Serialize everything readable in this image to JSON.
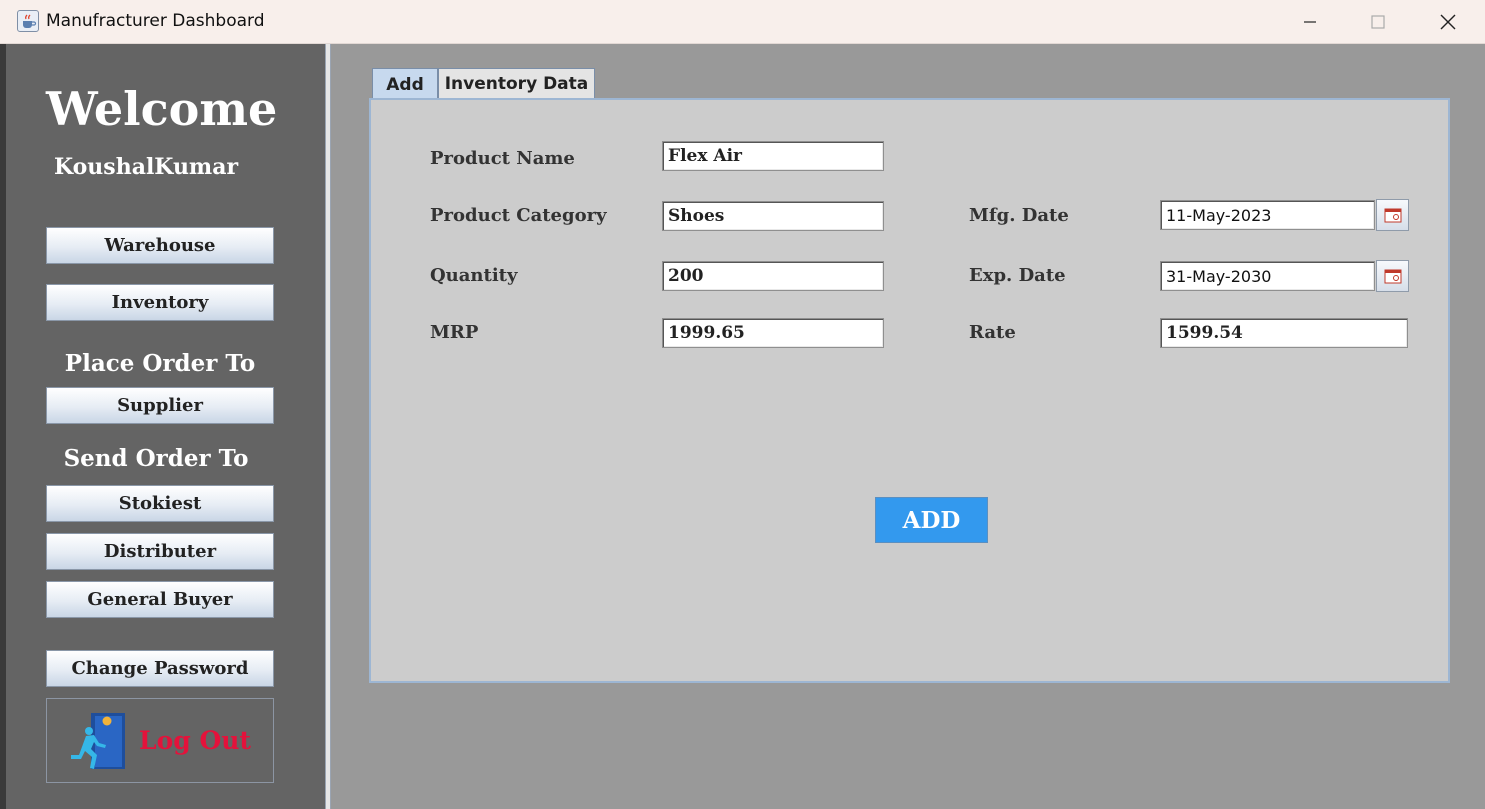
{
  "window": {
    "title": "Manufracturer Dashboard",
    "icon": "java-cup-icon"
  },
  "sidebar": {
    "welcome": "Welcome",
    "username": "KoushalKumar",
    "place_order_label": "Place Order To",
    "send_order_label": "Send Order To",
    "buttons": {
      "warehouse": "Warehouse",
      "inventory": "Inventory",
      "supplier": "Supplier",
      "stokiest": "Stokiest",
      "distributer": "Distributer",
      "general_buyer": "General Buyer",
      "change_password": "Change Password",
      "logout": "Log Out"
    }
  },
  "tabs": {
    "add": "Add",
    "inventory_data": "Inventory Data"
  },
  "form": {
    "product_name": {
      "label": "Product Name",
      "value": "Flex Air"
    },
    "product_category": {
      "label": "Product Category",
      "value": "Shoes"
    },
    "quantity": {
      "label": "Quantity",
      "value": "200"
    },
    "mrp": {
      "label": "MRP",
      "value": "1999.65"
    },
    "mfg_date": {
      "label": "Mfg. Date",
      "value": "11-May-2023"
    },
    "exp_date": {
      "label": "Exp. Date",
      "value": "31-May-2030"
    },
    "rate": {
      "label": "Rate",
      "value": "1599.54"
    },
    "submit_label": "ADD"
  },
  "colors": {
    "sidebar_bg": "#646464",
    "content_bg": "#999999",
    "panel_bg": "#cccccc",
    "accent_button": "#3399ee",
    "logout_text": "#e4123b"
  }
}
